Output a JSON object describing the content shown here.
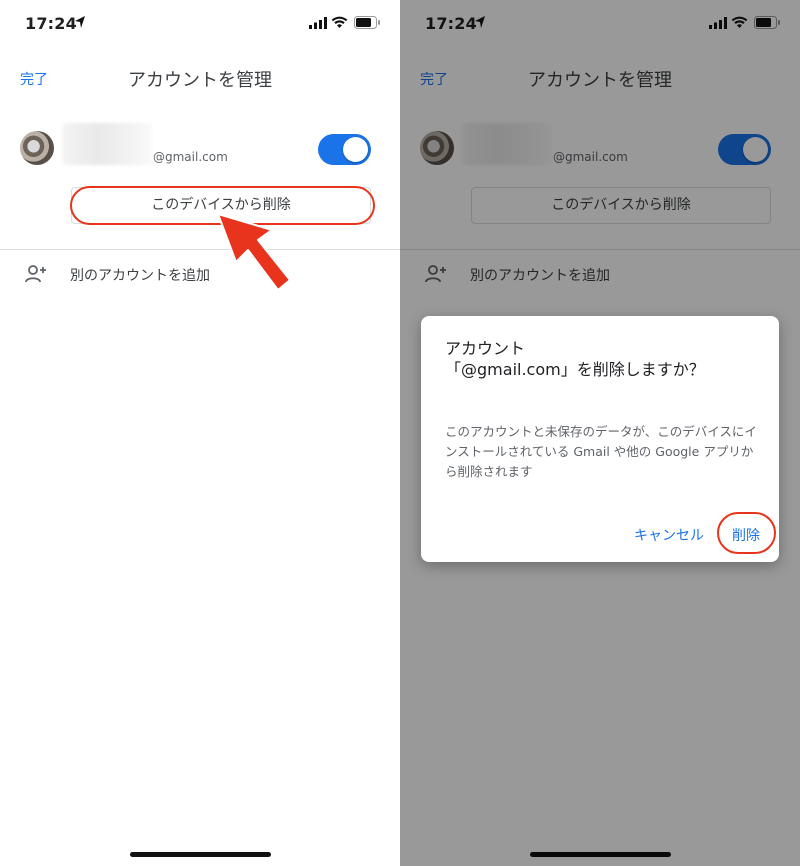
{
  "status_bar": {
    "time": "17:24"
  },
  "nav": {
    "done_label": "完了",
    "title": "アカウントを管理"
  },
  "account": {
    "email": "@gmail.com"
  },
  "buttons": {
    "remove_label": "このデバイスから削除"
  },
  "add_account": {
    "label": "別のアカウントを追加"
  },
  "dialog": {
    "title_prefix": "アカウント",
    "title_open": "「",
    "title_email": "@gmail.com",
    "title_close": "」を削除しますか？",
    "body": "このアカウントと未保存のデータが、このデバイスにインストールされている Gmail や他の Google アプリから削除されます",
    "cancel_label": "キャンセル",
    "delete_label": "削除"
  },
  "icons": {
    "location": "location-arrow-icon",
    "signal": "cellular-signal-icon",
    "wifi": "wifi-icon",
    "battery": "battery-icon",
    "add_person": "person-add-icon",
    "annotation_arrow": "red-arrow-icon"
  },
  "colors": {
    "accent": "#1a73e8",
    "annotation": "#e8341c",
    "scrim": "#000000"
  },
  "toggle": {
    "on": true
  }
}
